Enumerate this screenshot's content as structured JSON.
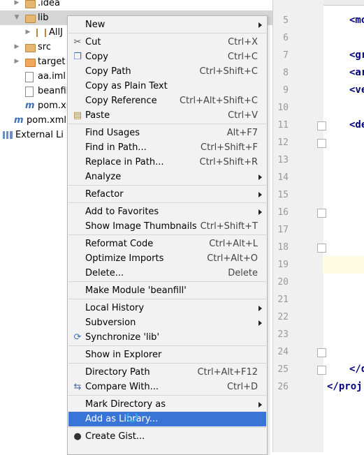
{
  "tree": {
    "rows": [
      {
        "label": ".idea",
        "arrow": "▶",
        "icon": "folder-icon",
        "indent": 1
      },
      {
        "label": "lib",
        "arrow": "▼",
        "icon": "folder-icon",
        "indent": 1,
        "selected": true
      },
      {
        "label": "AllJ",
        "arrow": "▶",
        "icon": "library-icon",
        "indent": 2
      },
      {
        "label": "src",
        "arrow": "▶",
        "icon": "folder-icon",
        "indent": 1
      },
      {
        "label": "target",
        "arrow": "▶",
        "icon": "folder-orange-icon",
        "indent": 1
      },
      {
        "label": "aa.iml",
        "arrow": "",
        "icon": "iml-file-icon",
        "indent": 1
      },
      {
        "label": "beanfil",
        "arrow": "",
        "icon": "iml-file-icon",
        "indent": 1
      },
      {
        "label": "pom.xn",
        "arrow": "",
        "icon": "maven-icon",
        "indent": 1
      },
      {
        "label": "pom.xml",
        "arrow": "",
        "icon": "maven-icon",
        "indent": 0
      },
      {
        "label": "External Li",
        "arrow": "▶",
        "icon": "external-libraries-icon",
        "indent": -1
      }
    ]
  },
  "editor": {
    "line_numbers": [
      "5",
      "6",
      "7",
      "8",
      "9",
      "10",
      "11",
      "12",
      "13",
      "14",
      "15",
      "16",
      "17",
      "18",
      "19",
      "20",
      "21",
      "22",
      "23",
      "24",
      "25",
      "26"
    ],
    "code": [
      {
        "line": "5",
        "text": "<mo"
      },
      {
        "line": "7",
        "text": "<gr"
      },
      {
        "line": "8",
        "text": "<ar"
      },
      {
        "line": "9",
        "text": "<ve"
      },
      {
        "line": "11",
        "text": "<de"
      },
      {
        "line": "25",
        "text": "</d"
      },
      {
        "line": "26",
        "text": "</proj"
      }
    ]
  },
  "menu": {
    "items": [
      {
        "label": "New",
        "shortcut": "",
        "submenu": true
      },
      {
        "sep": true
      },
      {
        "label": "Cut",
        "shortcut": "Ctrl+X",
        "icon": "scissors-icon"
      },
      {
        "label": "Copy",
        "shortcut": "Ctrl+C",
        "icon": "copy-icon"
      },
      {
        "label": "Copy Path",
        "shortcut": "Ctrl+Shift+C"
      },
      {
        "label": "Copy as Plain Text",
        "shortcut": ""
      },
      {
        "label": "Copy Reference",
        "shortcut": "Ctrl+Alt+Shift+C"
      },
      {
        "label": "Paste",
        "shortcut": "Ctrl+V",
        "icon": "paste-icon"
      },
      {
        "sep": true
      },
      {
        "label": "Find Usages",
        "shortcut": "Alt+F7"
      },
      {
        "label": "Find in Path...",
        "shortcut": "Ctrl+Shift+F"
      },
      {
        "label": "Replace in Path...",
        "shortcut": "Ctrl+Shift+R"
      },
      {
        "label": "Analyze",
        "shortcut": "",
        "submenu": true
      },
      {
        "sep": true
      },
      {
        "label": "Refactor",
        "shortcut": "",
        "submenu": true
      },
      {
        "sep": true
      },
      {
        "label": "Add to Favorites",
        "shortcut": "",
        "submenu": true
      },
      {
        "label": "Show Image Thumbnails",
        "shortcut": "Ctrl+Shift+T"
      },
      {
        "sep": true
      },
      {
        "label": "Reformat Code",
        "shortcut": "Ctrl+Alt+L"
      },
      {
        "label": "Optimize Imports",
        "shortcut": "Ctrl+Alt+O"
      },
      {
        "label": "Delete...",
        "shortcut": "Delete"
      },
      {
        "sep": true
      },
      {
        "label": "Make Module 'beanfill'",
        "shortcut": ""
      },
      {
        "sep": true
      },
      {
        "label": "Local History",
        "shortcut": "",
        "submenu": true
      },
      {
        "label": "Subversion",
        "shortcut": "",
        "submenu": true
      },
      {
        "label": "Synchronize 'lib'",
        "shortcut": "",
        "icon": "sync-icon"
      },
      {
        "sep": true
      },
      {
        "label": "Show in Explorer",
        "shortcut": ""
      },
      {
        "sep": true
      },
      {
        "label": "Directory Path",
        "shortcut": "Ctrl+Alt+F12"
      },
      {
        "label": "Compare With...",
        "shortcut": "Ctrl+D",
        "icon": "compare-icon"
      },
      {
        "sep": true
      },
      {
        "label": "Mark Directory as",
        "shortcut": "",
        "submenu": true
      },
      {
        "label": "Add as Library...",
        "shortcut": "",
        "highlighted": true
      },
      {
        "sep": true
      },
      {
        "label": "Create Gist...",
        "shortcut": "",
        "icon": "github-icon"
      }
    ]
  }
}
